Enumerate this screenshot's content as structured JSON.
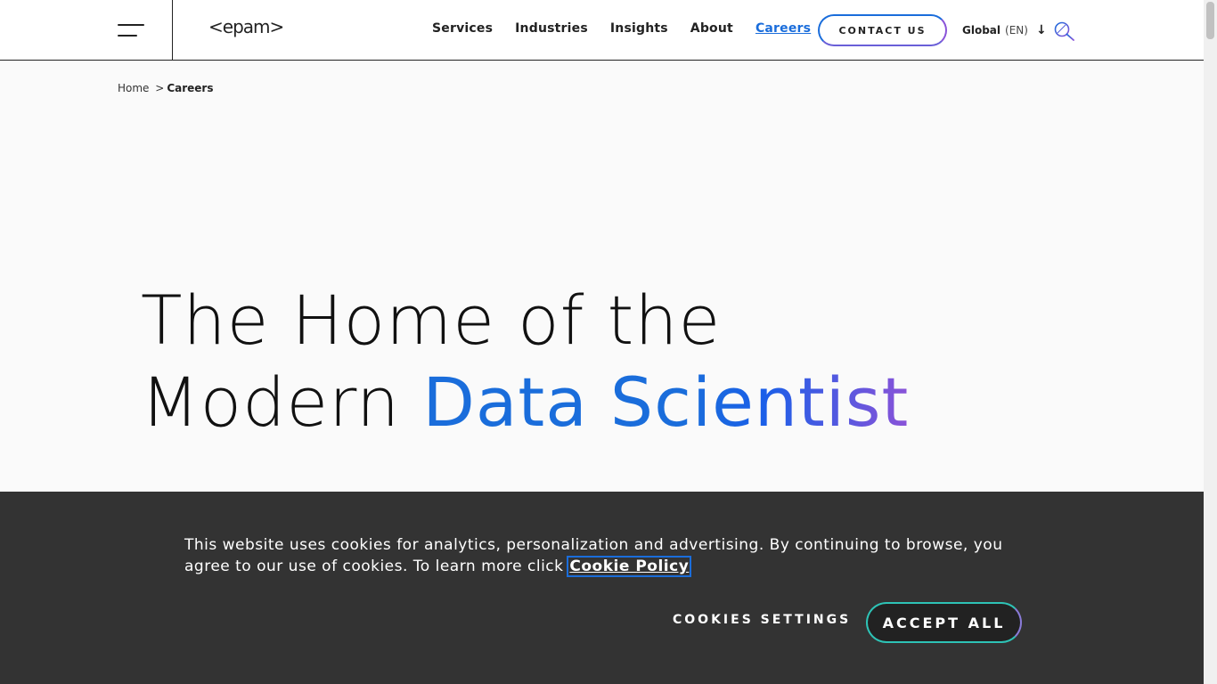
{
  "header": {
    "logo": "<epam>",
    "nav": [
      "Services",
      "Industries",
      "Insights",
      "About",
      "Careers"
    ],
    "active_nav": "Careers",
    "contact_label": "CONTACT US",
    "lang_label": "Global",
    "lang_code": "(EN)"
  },
  "breadcrumb": {
    "home": "Home",
    "separator": ">",
    "current": "Careers"
  },
  "hero": {
    "line1": "The Home of the",
    "line2_plain": "Modern ",
    "line2_highlight": "Data Scientist"
  },
  "cookie_banner": {
    "text": "This website uses cookies for analytics, personalization and advertising. By continuing to browse, you agree to our use of cookies. To learn more click ",
    "link_label": "Cookie Policy",
    "settings_label": "COOKIES SETTINGS",
    "accept_label": "ACCEPT ALL"
  },
  "colors": {
    "accent_blue": "#1a6ddb",
    "accent_purple": "#8a53d8",
    "accent_teal": "#2ec3b6",
    "banner_bg": "#333333"
  }
}
